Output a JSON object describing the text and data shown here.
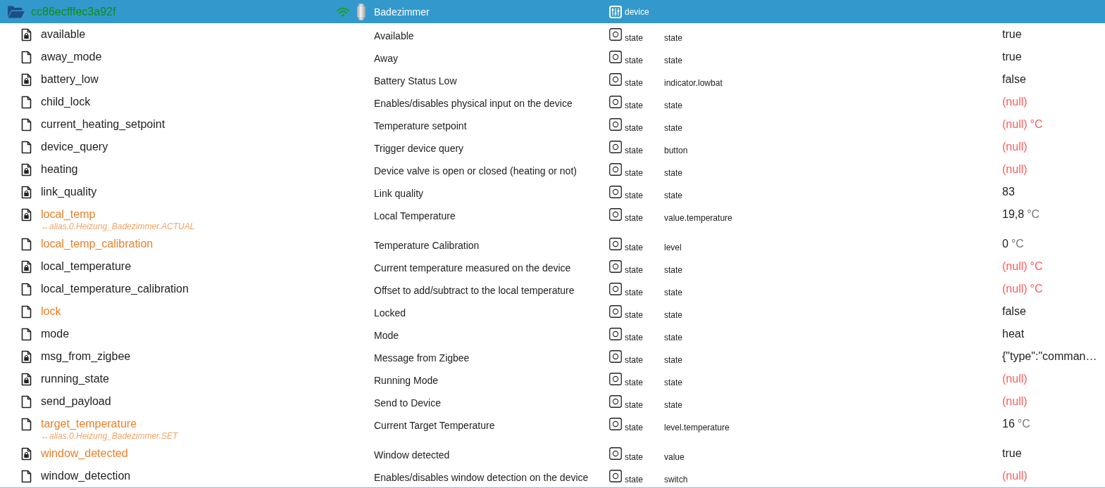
{
  "device": {
    "id": "cc86ecfffec3a92f",
    "name": "Badezimmer",
    "type": "device",
    "selected": true,
    "expanded": true
  },
  "rows": [
    {
      "id": "available",
      "name": "Available",
      "type": "state",
      "role": "state",
      "value": "true",
      "is_null": false,
      "read_only": true,
      "highlighted": false,
      "selected": false
    },
    {
      "id": "away_mode",
      "name": "Away",
      "type": "state",
      "role": "state",
      "value": "true",
      "is_null": false,
      "read_only": false,
      "highlighted": false,
      "selected": false
    },
    {
      "id": "battery_low",
      "name": "Battery Status Low",
      "type": "state",
      "role": "indicator.lowbat",
      "value": "false",
      "is_null": false,
      "read_only": true,
      "highlighted": false,
      "selected": false
    },
    {
      "id": "child_lock",
      "name": "Enables/disables physical input on the device",
      "type": "state",
      "role": "state",
      "value": "(null)",
      "is_null": true,
      "read_only": false,
      "highlighted": false,
      "selected": false
    },
    {
      "id": "current_heating_setpoint",
      "name": "Temperature setpoint",
      "type": "state",
      "role": "state",
      "value": "(null)",
      "unit": "°C",
      "is_null": true,
      "read_only": false,
      "highlighted": false,
      "selected": false
    },
    {
      "id": "device_query",
      "name": "Trigger device query",
      "type": "state",
      "role": "button",
      "value": "(null)",
      "is_null": true,
      "read_only": false,
      "highlighted": false,
      "selected": false
    },
    {
      "id": "heating",
      "name": "Device valve is open or closed (heating or not)",
      "type": "state",
      "role": "state",
      "value": "(null)",
      "is_null": true,
      "read_only": true,
      "highlighted": false,
      "selected": false
    },
    {
      "id": "link_quality",
      "name": "Link quality",
      "type": "state",
      "role": "state",
      "value": "83",
      "is_null": false,
      "read_only": true,
      "highlighted": false,
      "selected": false
    },
    {
      "id": "local_temp",
      "alias": "↔alias.0.Heizung_Badezimmer.ACTUAL",
      "name": "Local Temperature",
      "type": "state",
      "role": "value.temperature",
      "value": "19,8",
      "unit": "°C",
      "is_null": false,
      "read_only": true,
      "highlighted": true,
      "selected": false
    },
    {
      "id": "local_temp_calibration",
      "name": "Temperature Calibration",
      "type": "state",
      "role": "level",
      "value": "0",
      "unit": "°C",
      "is_null": false,
      "read_only": false,
      "highlighted": true,
      "selected": false
    },
    {
      "id": "local_temperature",
      "name": "Current temperature measured on the device",
      "type": "state",
      "role": "state",
      "value": "(null)",
      "unit": "°C",
      "is_null": true,
      "read_only": true,
      "highlighted": false,
      "selected": false
    },
    {
      "id": "local_temperature_calibration",
      "name": "Offset to add/subtract to the local temperature",
      "type": "state",
      "role": "state",
      "value": "(null)",
      "unit": "°C",
      "is_null": true,
      "read_only": false,
      "highlighted": false,
      "selected": false
    },
    {
      "id": "lock",
      "name": "Locked",
      "type": "state",
      "role": "state",
      "value": "false",
      "is_null": false,
      "read_only": false,
      "highlighted": true,
      "selected": false
    },
    {
      "id": "mode",
      "name": "Mode",
      "type": "state",
      "role": "state",
      "value": "heat",
      "is_null": false,
      "read_only": false,
      "highlighted": false,
      "selected": false
    },
    {
      "id": "msg_from_zigbee",
      "name": "Message from Zigbee",
      "type": "state",
      "role": "state",
      "value": "{\"type\":\"comman…",
      "is_null": false,
      "read_only": true,
      "highlighted": false,
      "selected": false
    },
    {
      "id": "running_state",
      "name": "Running Mode",
      "type": "state",
      "role": "state",
      "value": "(null)",
      "is_null": true,
      "read_only": true,
      "highlighted": false,
      "selected": false
    },
    {
      "id": "send_payload",
      "name": "Send to Device",
      "type": "state",
      "role": "state",
      "value": "(null)",
      "is_null": true,
      "read_only": false,
      "highlighted": false,
      "selected": false
    },
    {
      "id": "target_temperature",
      "alias": "↔alias.0.Heizung_Badezimmer.SET",
      "name": "Current Target Temperature",
      "type": "state",
      "role": "level.temperature",
      "value": "16",
      "unit": "°C",
      "is_null": false,
      "read_only": false,
      "highlighted": true,
      "selected": false
    },
    {
      "id": "window_detected",
      "name": "Window detected",
      "type": "state",
      "role": "value",
      "value": "true",
      "is_null": false,
      "read_only": true,
      "highlighted": true,
      "selected": false
    },
    {
      "id": "window_detection",
      "name": "Enables/disables window detection on the device",
      "type": "state",
      "role": "switch",
      "value": "(null)",
      "is_null": true,
      "read_only": false,
      "highlighted": false,
      "selected": false
    }
  ]
}
